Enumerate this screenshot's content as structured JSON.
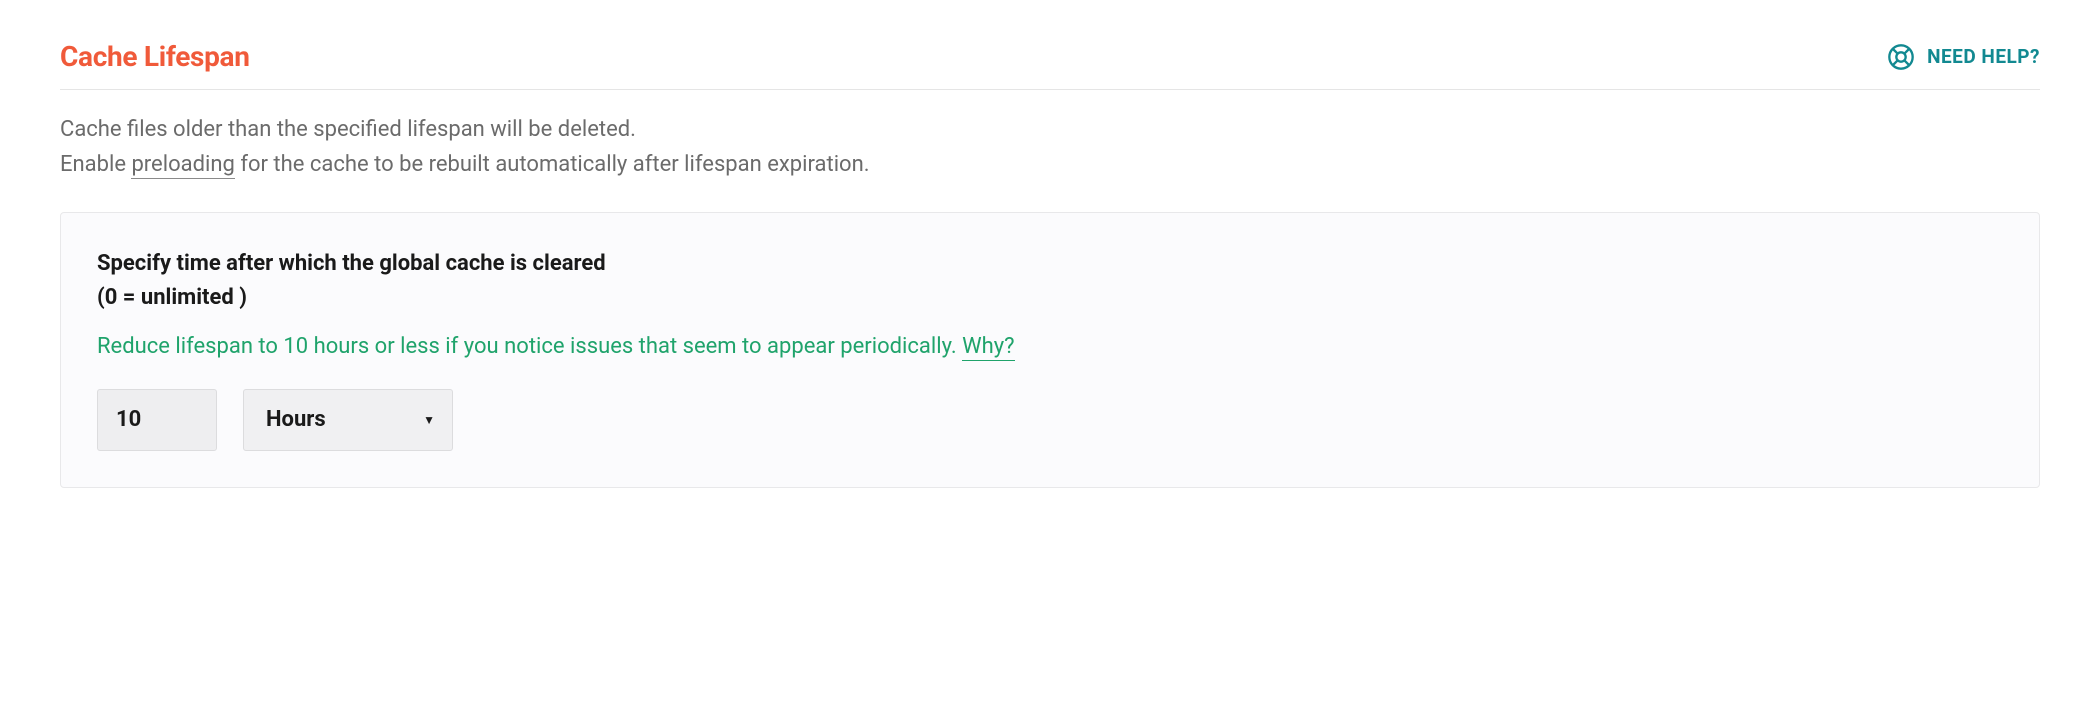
{
  "header": {
    "title": "Cache Lifespan",
    "help_label": "NEED HELP?"
  },
  "description": {
    "line1": "Cache files older than the specified lifespan will be deleted.",
    "line2_prefix": "Enable ",
    "line2_link": "preloading",
    "line2_suffix": " for the cache to be rebuilt automatically after lifespan expiration."
  },
  "settings": {
    "heading_line1": "Specify time after which the global cache is cleared",
    "heading_line2": "(0 = unlimited )",
    "hint_prefix": "Reduce lifespan to 10 hours or less if you notice issues that seem to appear periodically. ",
    "hint_link": "Why?",
    "value": "10",
    "unit_selected": "Hours"
  },
  "colors": {
    "accent_title": "#f05a3a",
    "help_link": "#128991",
    "hint_green": "#1fa36b"
  }
}
